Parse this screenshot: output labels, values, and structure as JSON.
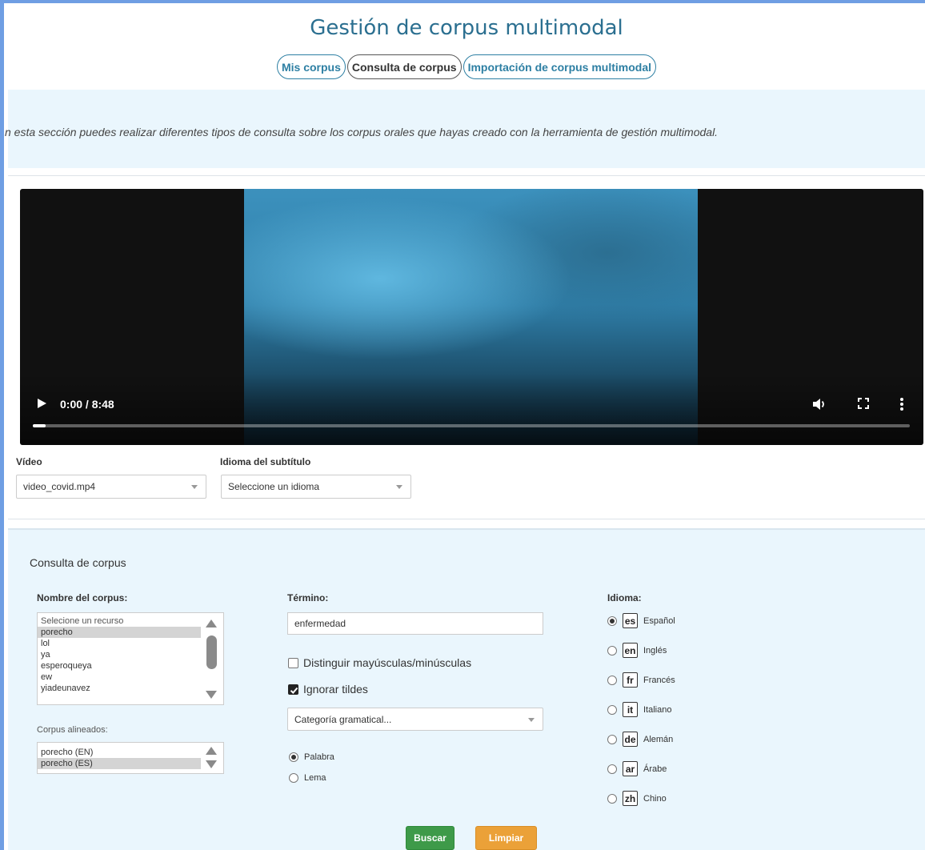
{
  "header": {
    "title": "Gestión de corpus multimodal",
    "tabs": [
      {
        "label": "Mis corpus",
        "active": false
      },
      {
        "label": "Consulta de corpus",
        "active": true
      },
      {
        "label": "Importación de corpus multimodal",
        "active": false
      }
    ]
  },
  "info": {
    "text": "n esta sección puedes realizar diferentes tipos de consulta sobre los corpus orales que hayas creado con la herramienta de gestión multimodal."
  },
  "player": {
    "time": "0:00 / 8:48",
    "progress": 0.015
  },
  "video_select": {
    "label": "Vídeo",
    "value": "video_covid.mp4"
  },
  "subtitle_select": {
    "label": "Idioma del subtítulo",
    "value": "Seleccione un idioma"
  },
  "query": {
    "title": "Consulta de corpus",
    "corpus_label": "Nombre del corpus:",
    "corpus_options": [
      "Selecione un recurso",
      "porecho",
      "lol",
      "ya",
      "esperoqueya",
      "ew",
      "yiadeunavez"
    ],
    "corpus_selected_index": 1,
    "aligned_label": "Corpus alineados:",
    "aligned_options": [
      "porecho (EN)",
      "porecho (ES)"
    ],
    "aligned_selected_index": 1,
    "term_label": "Término:",
    "term_value": "enfermedad",
    "case_label": "Distinguir mayúsculas/minúsculas",
    "case_checked": false,
    "accents_label": "Ignorar tildes",
    "accents_checked": true,
    "category_placeholder": "Categoría gramatical...",
    "mode_options": [
      {
        "label": "Palabra",
        "checked": true
      },
      {
        "label": "Lema",
        "checked": false
      }
    ],
    "language_label": "Idioma:",
    "languages": [
      {
        "code": "es",
        "name": "Español",
        "checked": true
      },
      {
        "code": "en",
        "name": "Inglés",
        "checked": false
      },
      {
        "code": "fr",
        "name": "Francés",
        "checked": false
      },
      {
        "code": "it",
        "name": "Italiano",
        "checked": false
      },
      {
        "code": "de",
        "name": "Alemán",
        "checked": false
      },
      {
        "code": "ar",
        "name": "Árabe",
        "checked": false
      },
      {
        "code": "zh",
        "name": "Chino",
        "checked": false
      }
    ],
    "search_label": "Buscar",
    "clear_label": "Limpiar"
  },
  "colors": {
    "accent": "#2d7fa3",
    "panel_bg": "#eaf6fd",
    "search_green": "#3e9a49",
    "clear_orange": "#eba138"
  }
}
